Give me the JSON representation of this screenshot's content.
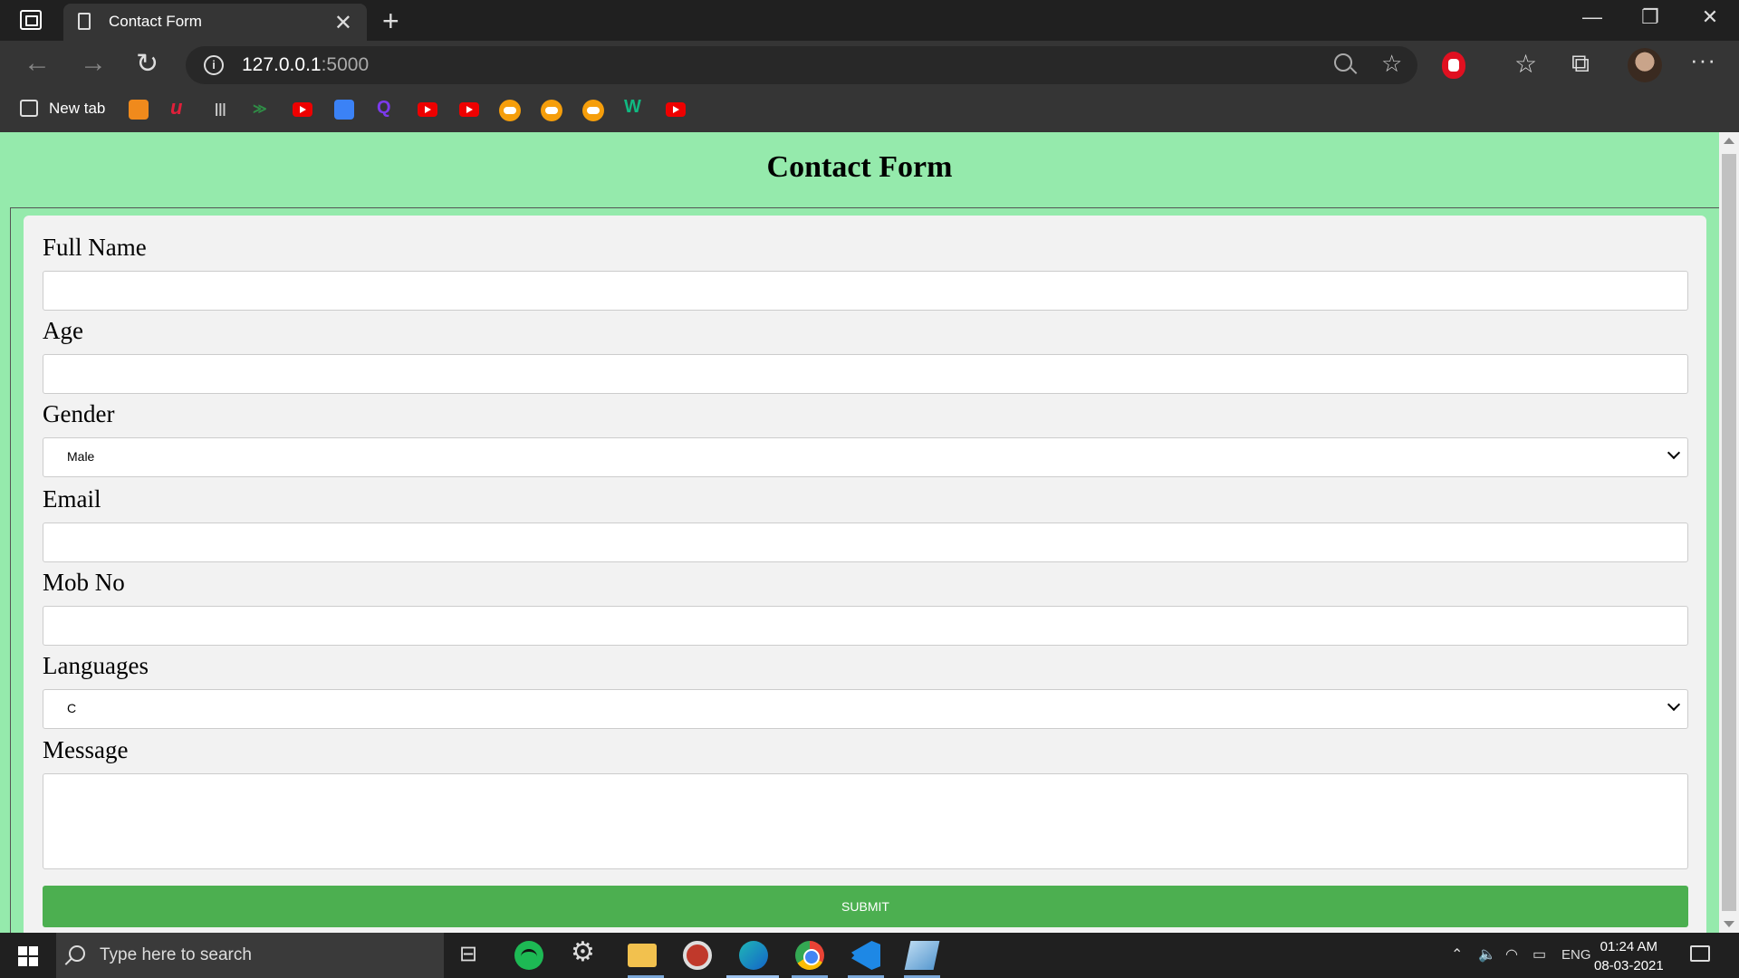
{
  "browser": {
    "tab_title": "Contact Form",
    "tab_close": "✕",
    "new_tab_symbol": "+",
    "window_controls": [
      "—",
      "❐",
      "✕"
    ],
    "url_host": "127.0.0.1",
    "url_port": ":5000",
    "more_symbol": "···"
  },
  "bookmarks": {
    "new_tab_label": "New tab",
    "icons": [
      "orange-fox-icon",
      "udemy-icon",
      "bars-icon",
      "gfg-icon",
      "youtube-icon",
      "contacts-icon",
      "quora-icon",
      "youtube-icon",
      "youtube-icon",
      "circle-orange-icon",
      "circle-orange-icon",
      "circle-orange-icon",
      "wg-icon",
      "youtube-icon"
    ]
  },
  "page": {
    "title": "Contact Form",
    "labels": {
      "full_name": "Full Name",
      "age": "Age",
      "gender": "Gender",
      "email": "Email",
      "mob_no": "Mob No",
      "languages": "Languages",
      "message": "Message"
    },
    "values": {
      "full_name": "",
      "age": "",
      "gender": "Male",
      "email": "",
      "mob_no": "",
      "languages": "C",
      "message": ""
    },
    "submit_label": "SUBMIT",
    "colors": {
      "background": "#95eaac",
      "card": "#f2f2f2",
      "submit": "#4caf50"
    }
  },
  "taskbar": {
    "search_placeholder": "Type here to search",
    "language": "ENG",
    "time": "01:24 AM",
    "date": "08-03-2021"
  }
}
